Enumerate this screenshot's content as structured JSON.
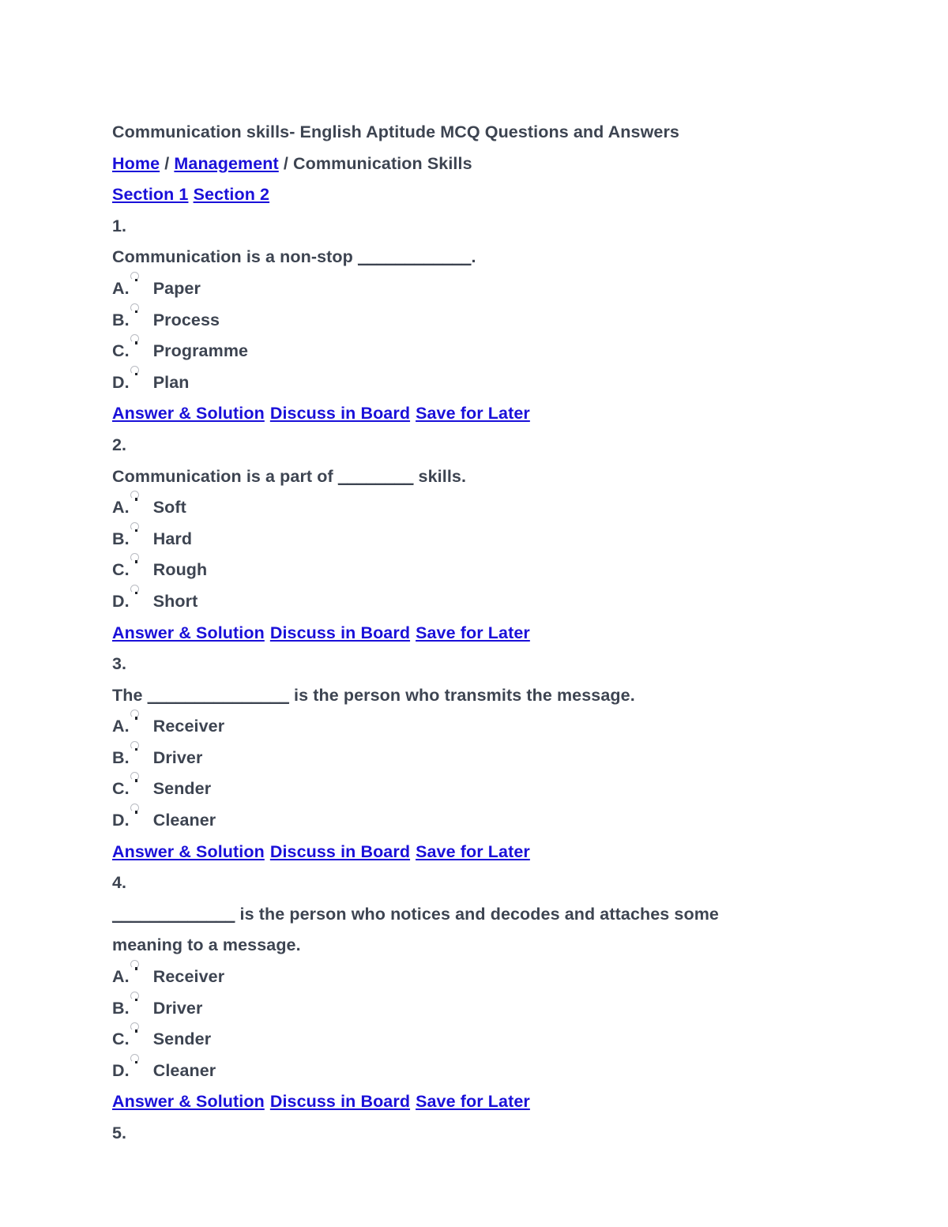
{
  "document": {
    "title": "Communication skills- English Aptitude MCQ Questions and Answers",
    "breadcrumb": {
      "home": "Home",
      "separator": " / ",
      "category": "Management",
      "current": "Communication Skills"
    },
    "sections": {
      "section1": "Section 1",
      "section2": "Section 2"
    },
    "action_links": {
      "answer": "Answer & Solution",
      "discuss": "Discuss in Board",
      "save": "Save for Later"
    },
    "colors": {
      "text": "#3d4451",
      "link": "#1a10d9",
      "background": "#ffffff"
    },
    "questions": [
      {
        "number": "1.",
        "text_before": "Communication is a non-stop ",
        "blank": "____________",
        "text_after": ".",
        "text_line2": "",
        "options": [
          {
            "letter": "A.",
            "label": "Paper"
          },
          {
            "letter": "B.",
            "label": "Process"
          },
          {
            "letter": "C.",
            "label": "Programme"
          },
          {
            "letter": "D.",
            "label": "Plan"
          }
        ]
      },
      {
        "number": "2.",
        "text_before": "Communication is a part of ",
        "blank": "________",
        "text_after": " skills.",
        "text_line2": "",
        "options": [
          {
            "letter": "A.",
            "label": "Soft"
          },
          {
            "letter": "B.",
            "label": "Hard"
          },
          {
            "letter": "C.",
            "label": "Rough"
          },
          {
            "letter": "D.",
            "label": "Short"
          }
        ]
      },
      {
        "number": "3.",
        "text_before": "The ",
        "blank": "_______________",
        "text_after": " is the person who transmits the message.",
        "text_line2": "",
        "options": [
          {
            "letter": "A.",
            "label": "Receiver"
          },
          {
            "letter": "B.",
            "label": "Driver"
          },
          {
            "letter": "C.",
            "label": "Sender"
          },
          {
            "letter": "D.",
            "label": "Cleaner"
          }
        ]
      },
      {
        "number": "4.",
        "text_before": "",
        "blank": "_____________",
        "text_after": " is the person who notices and decodes and attaches some meaning to a message.",
        "text_line2": "",
        "options": [
          {
            "letter": "A.",
            "label": "Receiver"
          },
          {
            "letter": "B.",
            "label": "Driver"
          },
          {
            "letter": "C.",
            "label": "Sender"
          },
          {
            "letter": "D.",
            "label": "Cleaner"
          }
        ]
      }
    ],
    "next_question_number": "5.",
    "radio_icon": "radio-button-icon"
  }
}
